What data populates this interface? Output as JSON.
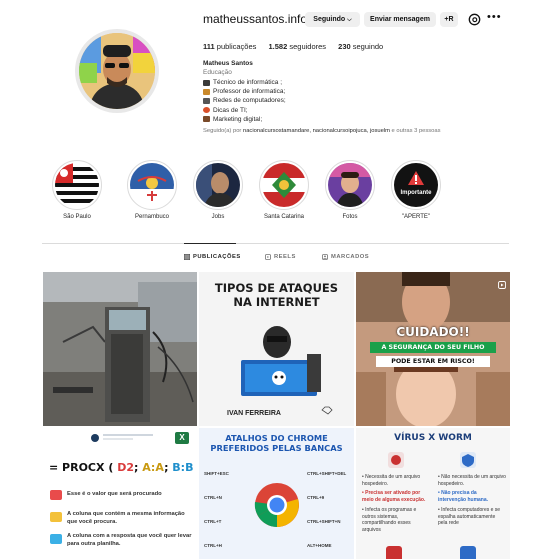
{
  "profile": {
    "username": "matheussantos.info",
    "follow_button": "Seguindo",
    "message_button": "Enviar mensagem",
    "add_button": "+R",
    "stats": {
      "posts_count": "111",
      "posts_label": "publicações",
      "followers_count": "1.582",
      "followers_label": "seguidores",
      "following_count": "230",
      "following_label": "seguindo"
    },
    "full_name": "Matheus Santos",
    "category": "Educação",
    "bio": [
      {
        "text": "Técnico de informática ;",
        "color": "#3a3a3a"
      },
      {
        "text": "Professor de informatica;",
        "color": "#c9892b"
      },
      {
        "text": "Redes de computadores;",
        "color": "#555555"
      },
      {
        "text": "Dicas de TI;",
        "color": "#d9502a"
      },
      {
        "text": "Marketing digital;",
        "color": "#7a4a2a"
      }
    ],
    "followed_prefix": "Seguido(a) por",
    "followed_by": "nacionalcursostamandare, nacionalcursoipojuca, josuelm",
    "followed_suffix": "e outras 3 pessoas"
  },
  "highlights": [
    {
      "label": "São Paulo",
      "icon": "sao-paulo-flag"
    },
    {
      "label": "Pernambuco",
      "icon": "pernambuco-flag"
    },
    {
      "label": "Jobs",
      "icon": "person-photo"
    },
    {
      "label": "Santa Catarina",
      "icon": "santa-catarina-flag"
    },
    {
      "label": "Fotos",
      "icon": "person-photo"
    },
    {
      "label": "\"APERTE\"",
      "icon": "importante-badge"
    }
  ],
  "tabs": {
    "posts": "PUBLICAÇÕES",
    "reels": "REELS",
    "tagged": "MARCADOS"
  },
  "posts": {
    "p2": {
      "title_line1": "TIPOS DE ATAQUES",
      "title_line2": "NA INTERNET",
      "author": "IVAN FERREIRA"
    },
    "p3": {
      "headline": "CUIDADO!!",
      "line1": "A SEGURANÇA DO SEU FILHO",
      "line2": "PODE ESTAR EM RISCO!"
    },
    "p4": {
      "formula_prefix": "= PROCX (",
      "arg1": "D2",
      "arg2": "A:A",
      "arg3": "B:B",
      "formula_suffix": ")",
      "items": [
        {
          "text": "Esse é o valor que será procurado",
          "color": "#e94b4b"
        },
        {
          "text": "A coluna que contém a mesma informação que você procura.",
          "color": "#f3c13a"
        },
        {
          "text": "A coluna com a resposta que você quer levar para outra planilha.",
          "color": "#3bb0e6"
        }
      ]
    },
    "p5": {
      "title_line1": "ATALHOS DO CHROME",
      "title_line2": "PREFERIDOS PELAS BANCAS",
      "left": [
        "SHIFT+ESC",
        "CTRL+N",
        "CTRL+T",
        "CTRL+H"
      ],
      "right": [
        "CTRL+SHIFT+DEL",
        "CTRL+9",
        "CTRL+SHIFT+N",
        "ALT+HOME"
      ]
    },
    "p6": {
      "title": "VÍRUS X WORM",
      "left": [
        "Necessita de um arquivo hospedeiro.",
        "Precisa ser ativado por meio de alguma execução.",
        "Infecta os programas e outros sistemas, compartilhando esses arquivos"
      ],
      "right": [
        "Não necessita de um arquivo hospedeiro.",
        "Não precisa da intervenção humana.",
        "Infecta computadores e se espalha automaticamente pela rede"
      ]
    }
  }
}
